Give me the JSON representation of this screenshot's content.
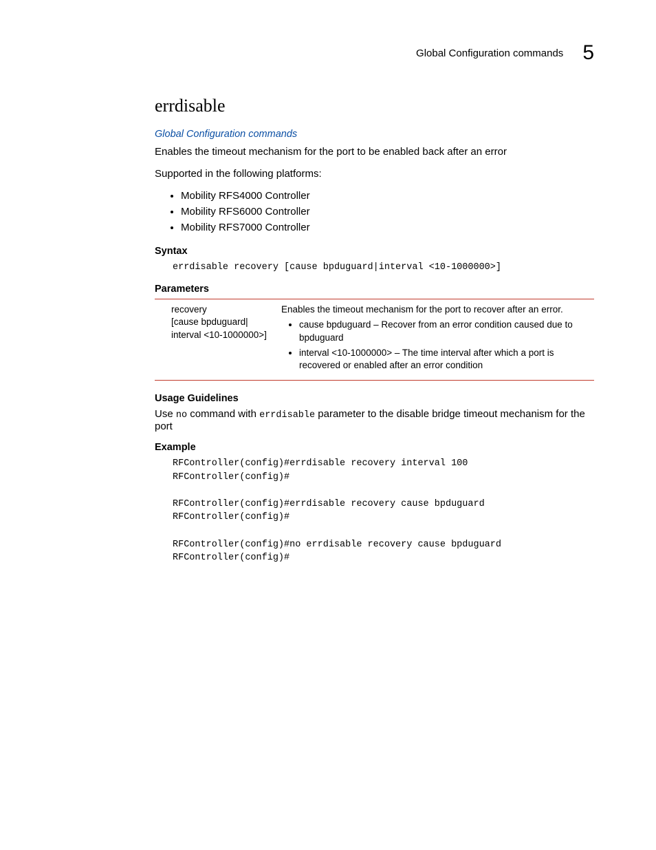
{
  "header": {
    "title": "Global Configuration commands",
    "chapter": "5"
  },
  "main": {
    "title": "errdisable",
    "link": "Global Configuration commands",
    "intro1": "Enables the timeout mechanism for the port to be enabled back after an error",
    "intro2": "Supported in the following platforms:",
    "platforms": [
      "Mobility RFS4000 Controller",
      "Mobility RFS6000 Controller",
      "Mobility RFS7000 Controller"
    ],
    "syntax_h": "Syntax",
    "syntax_code": "errdisable recovery [cause bpduguard|interval <10-1000000>]",
    "params_h": "Parameters",
    "params": {
      "left_line1": "recovery",
      "left_line2": "[cause bpduguard|",
      "left_line3": "interval <10-1000000>]",
      "right_intro": "Enables the timeout mechanism for the port to recover after an error.",
      "right_b1": "cause bpduguard – Recover from an error condition caused due to bpduguard",
      "right_b2": "interval <10-1000000> – The time interval after which a port is recovered or enabled after an error condition"
    },
    "usage_h": "Usage Guidelines",
    "usage_pre": "Use ",
    "usage_code1": "no",
    "usage_mid": " command with ",
    "usage_code2": "errdisable",
    "usage_post": " parameter to the disable bridge timeout mechanism for the port",
    "example_h": "Example",
    "example_code": "RFController(config)#errdisable recovery interval 100\nRFController(config)#\n\nRFController(config)#errdisable recovery cause bpduguard\nRFController(config)#\n\nRFController(config)#no errdisable recovery cause bpduguard\nRFController(config)#"
  }
}
